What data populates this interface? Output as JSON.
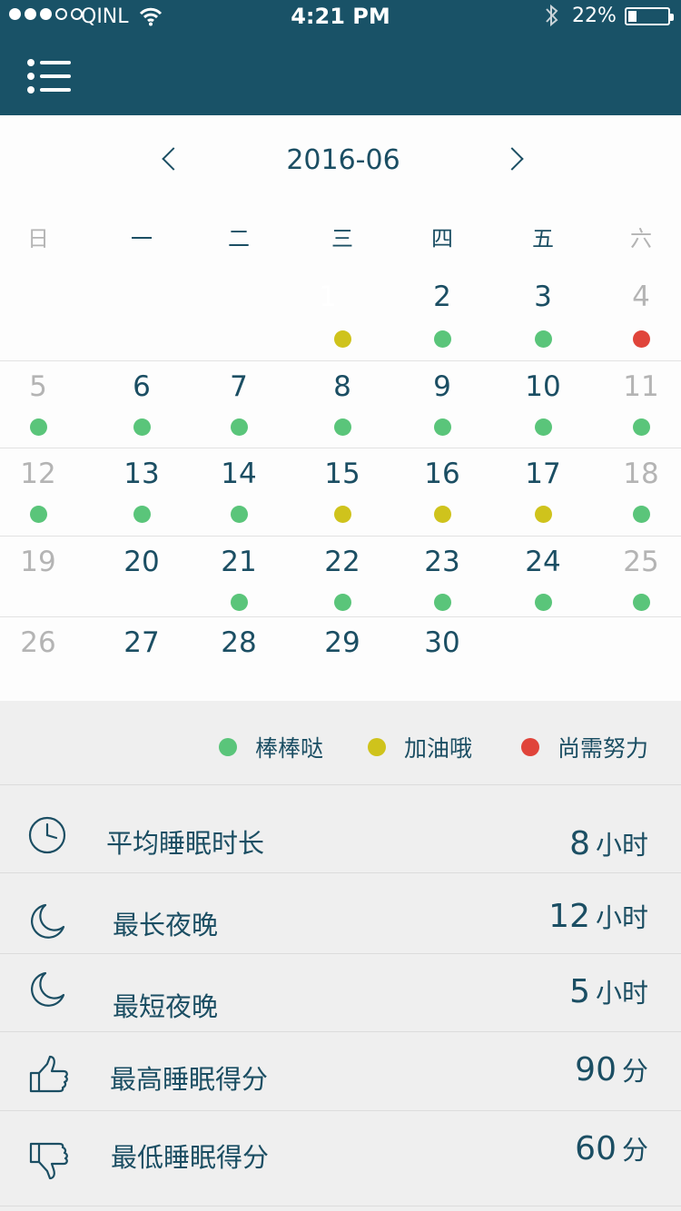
{
  "status_bar": {
    "carrier": "QINL",
    "time": "4:21 PM",
    "battery_percent": "22%",
    "battery_level": 0.22,
    "signal_bars": 3,
    "signal_total": 5
  },
  "header": {
    "menu_icon": "menu-list-icon"
  },
  "calendar": {
    "month": "2016-06",
    "weekdays": [
      "日",
      "一",
      "二",
      "三",
      "四",
      "五",
      "六"
    ],
    "selected_day": "1",
    "weeks": [
      [
        null,
        null,
        null,
        {
          "day": "1",
          "mood": "yellow"
        },
        {
          "day": "2",
          "mood": "green"
        },
        {
          "day": "3",
          "mood": "green"
        },
        {
          "day": "4",
          "mood": "red"
        }
      ],
      [
        {
          "day": "5",
          "mood": "green"
        },
        {
          "day": "6",
          "mood": "green"
        },
        {
          "day": "7",
          "mood": "green"
        },
        {
          "day": "8",
          "mood": "green"
        },
        {
          "day": "9",
          "mood": "green"
        },
        {
          "day": "10",
          "mood": "green"
        },
        {
          "day": "11",
          "mood": "green"
        }
      ],
      [
        {
          "day": "12",
          "mood": "green"
        },
        {
          "day": "13",
          "mood": "green"
        },
        {
          "day": "14",
          "mood": "green"
        },
        {
          "day": "15",
          "mood": "yellow"
        },
        {
          "day": "16",
          "mood": "yellow"
        },
        {
          "day": "17",
          "mood": "yellow"
        },
        {
          "day": "18",
          "mood": "green"
        }
      ],
      [
        {
          "day": "19",
          "mood": null
        },
        {
          "day": "20",
          "mood": null
        },
        {
          "day": "21",
          "mood": "green"
        },
        {
          "day": "22",
          "mood": "green"
        },
        {
          "day": "23",
          "mood": "green"
        },
        {
          "day": "24",
          "mood": "green"
        },
        {
          "day": "25",
          "mood": "green"
        }
      ],
      [
        {
          "day": "26",
          "mood": null
        },
        {
          "day": "27",
          "mood": null
        },
        {
          "day": "28",
          "mood": null
        },
        {
          "day": "29",
          "mood": null
        },
        {
          "day": "30",
          "mood": null
        },
        null,
        null
      ]
    ]
  },
  "legend": [
    {
      "label": "棒棒哒",
      "mood": "green"
    },
    {
      "label": "加油哦",
      "mood": "yellow"
    },
    {
      "label": "尚需努力",
      "mood": "red"
    }
  ],
  "stats": [
    {
      "icon": "clock-icon",
      "label": "平均睡眠时长",
      "value": "8",
      "unit": "小时"
    },
    {
      "icon": "moon-icon",
      "label": "最长夜晚",
      "value": "12",
      "unit": "小时"
    },
    {
      "icon": "moon-icon",
      "label": "最短夜晚",
      "value": "5",
      "unit": "小时"
    },
    {
      "icon": "thumbs-up-icon",
      "label": "最高睡眠得分",
      "value": "90",
      "unit": "分"
    },
    {
      "icon": "thumbs-down-icon",
      "label": "最低睡眠得分",
      "value": "60",
      "unit": "分"
    }
  ],
  "colors": {
    "primary": "#195267",
    "text": "#1b4e63",
    "weekend": "#b4b4b4",
    "green": "#5ac57a",
    "yellow": "#cfc31c",
    "red": "#e0443a"
  }
}
